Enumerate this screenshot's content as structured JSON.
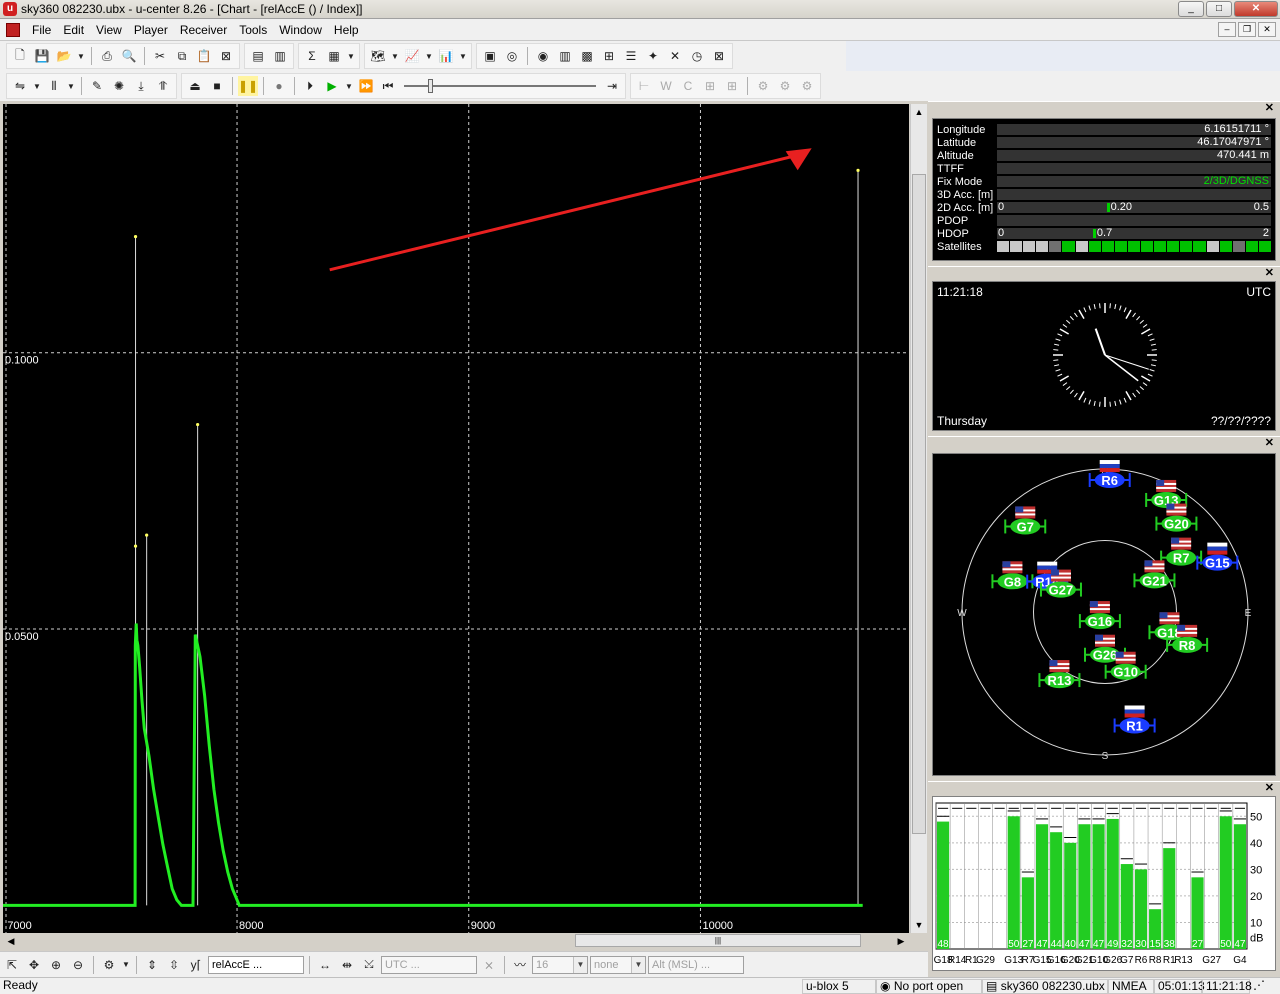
{
  "window": {
    "title": "sky360 082230.ubx - u-center 8.26 - [Chart - [relAccE () / Index]]",
    "min": "_",
    "max": "□",
    "close": "✕"
  },
  "menu": {
    "items": [
      "File",
      "Edit",
      "View",
      "Player",
      "Receiver",
      "Tools",
      "Window",
      "Help"
    ]
  },
  "chart": {
    "y_labels": [
      "0.1000",
      "0.0500"
    ],
    "x_labels": [
      "7000",
      "8000",
      "9000",
      "10000"
    ]
  },
  "chart_data": {
    "type": "line",
    "title": "",
    "xlabel": "",
    "ylabel": "",
    "xlim": [
      6990,
      10900
    ],
    "ylim": [
      -0.005,
      0.145
    ],
    "series": [
      {
        "color": "#22ee22",
        "x": [
          6990,
          7560,
          7561,
          7565,
          7568,
          7572,
          7580,
          7590,
          7600,
          7620,
          7640,
          7660,
          7680,
          7700,
          7720,
          7740,
          7760,
          7770,
          7780,
          7800,
          7810,
          7820,
          7840,
          7860,
          7880,
          7900,
          7920,
          7940,
          7960,
          7980,
          8000,
          8010,
          8030,
          8100,
          8500,
          9000,
          9500,
          10000,
          10500,
          10700
        ],
        "y": [
          0.0,
          0.0,
          0.047,
          0.051,
          0.048,
          0.047,
          0.043,
          0.037,
          0.032,
          0.027,
          0.021,
          0.016,
          0.011,
          0.007,
          0.003,
          0.001,
          0.0,
          0.0,
          0.0,
          0.0,
          0.0,
          0.049,
          0.045,
          0.038,
          0.029,
          0.021,
          0.015,
          0.01,
          0.006,
          0.003,
          0.001,
          0.0,
          0.0,
          0.0,
          0.0,
          0.0,
          0.0,
          0.0,
          0.0,
          0.0
        ]
      }
    ],
    "spikes": [
      {
        "x": 7562,
        "y": 0.121
      },
      {
        "x": 7562,
        "y": 0.065
      },
      {
        "x": 7610,
        "y": 0.067
      },
      {
        "x": 7830,
        "y": 0.087
      },
      {
        "x": 10680,
        "y": 0.133
      }
    ],
    "gridlines_x": [
      8000,
      9000,
      10000
    ],
    "gridlines_y": [
      0.05,
      0.1
    ],
    "annotation": "red arrow pointing to final spike"
  },
  "data_view": {
    "rows": [
      {
        "label": "Longitude",
        "value": "6.16151711 °"
      },
      {
        "label": "Latitude",
        "value": "46.17047971 °"
      },
      {
        "label": "Altitude",
        "value": "470.441 m"
      },
      {
        "label": "TTFF",
        "value": ""
      },
      {
        "label": "Fix Mode",
        "value": "2/3D/DGNSS"
      },
      {
        "label": "3D Acc. [m]",
        "value": ""
      }
    ],
    "acc2d": {
      "label": "2D Acc. [m]",
      "lo": "0",
      "val": "0.20",
      "hi": "0.5",
      "fraction": 0.4
    },
    "pdop": {
      "label": "PDOP"
    },
    "hdop": {
      "label": "HDOP",
      "lo": "0",
      "val": "0.7",
      "hi": "2",
      "fraction": 0.35
    },
    "satellites": {
      "label": "Satellites",
      "cells": [
        "#c8c8c8",
        "#c8c8c8",
        "#c8c8c8",
        "#c8c8c8",
        "#707070",
        "#00c000",
        "#c8c8c8",
        "#00c000",
        "#00c000",
        "#00c000",
        "#00c000",
        "#00c000",
        "#00c000",
        "#00c000",
        "#00c000",
        "#00c000",
        "#c8c8c8",
        "#00c000",
        "#707070",
        "#00c000",
        "#00c000"
      ]
    }
  },
  "clock": {
    "time": "11:21:18",
    "zone": "UTC",
    "day": "Thursday",
    "date": "??/??/????"
  },
  "sky": {
    "north": "N",
    "south": "S",
    "east": "E",
    "west": "W",
    "sats": [
      {
        "id": "R6",
        "sys": "R",
        "az": 2,
        "el": 5
      },
      {
        "id": "G13",
        "sys": "G",
        "az": 28,
        "el": 8
      },
      {
        "id": "G7",
        "sys": "G",
        "az": 318,
        "el": 15
      },
      {
        "id": "G20",
        "sys": "G",
        "az": 38,
        "el": 17
      },
      {
        "id": "R7",
        "sys": "G",
        "az": 53,
        "el": 30
      },
      {
        "id": "G15",
        "sys": "R",
        "az": 65,
        "el": 12
      },
      {
        "id": "G8",
        "sys": "G",
        "az": 290,
        "el": 28
      },
      {
        "id": "R14",
        "sys": "R",
        "az": 300,
        "el": 48
      },
      {
        "id": "G27",
        "sys": "G",
        "az": 300,
        "el": 58
      },
      {
        "id": "G21",
        "sys": "G",
        "az": 55,
        "el": 52
      },
      {
        "id": "G16",
        "sys": "G",
        "az": 220,
        "el": 85
      },
      {
        "id": "G18",
        "sys": "G",
        "az": 105,
        "el": 48
      },
      {
        "id": "R8",
        "sys": "G",
        "az": 110,
        "el": 35
      },
      {
        "id": "R13",
        "sys": "G",
        "az": 215,
        "el": 40
      },
      {
        "id": "G26",
        "sys": "G",
        "az": 180,
        "el": 65
      },
      {
        "id": "G10",
        "sys": "G",
        "az": 160,
        "el": 52
      },
      {
        "id": "R1",
        "sys": "R",
        "az": 165,
        "el": 18
      }
    ]
  },
  "signals": {
    "yticks": [
      "50",
      "40",
      "30",
      "20",
      "10"
    ],
    "unit": "dB",
    "bars": [
      {
        "name": "G18",
        "cn": 48,
        "label": "48",
        "col": "#22cc22"
      },
      {
        "name": "R14",
        "cn": 0,
        "label": "",
        "col": "#22cc22"
      },
      {
        "name": "R1",
        "cn": 0,
        "label": "",
        "col": "#22cc22"
      },
      {
        "name": "G29",
        "cn": 0,
        "label": "",
        "col": "#22cc22"
      },
      {
        "name": "",
        "cn": 0,
        "label": "",
        "col": "#22cc22"
      },
      {
        "name": "G13",
        "cn": 50,
        "label": "50",
        "col": "#22cc22"
      },
      {
        "name": "R7",
        "cn": 27,
        "label": "27",
        "col": "#22cc22"
      },
      {
        "name": "G15",
        "cn": 47,
        "label": "47",
        "col": "#22cc22"
      },
      {
        "name": "G16",
        "cn": 44,
        "label": "44",
        "col": "#22cc22"
      },
      {
        "name": "G20",
        "cn": 40,
        "label": "40",
        "col": "#22cc22"
      },
      {
        "name": "G21",
        "cn": 47,
        "label": "47",
        "col": "#22cc22"
      },
      {
        "name": "G10",
        "cn": 47,
        "label": "47",
        "col": "#22cc22"
      },
      {
        "name": "G26",
        "cn": 49,
        "label": "49",
        "col": "#22cc22"
      },
      {
        "name": "G7",
        "cn": 32,
        "label": "32",
        "col": "#22cc22"
      },
      {
        "name": "R6",
        "cn": 30,
        "label": "30",
        "col": "#22cc22"
      },
      {
        "name": "R8",
        "cn": 15,
        "label": "15",
        "col": "#22cc22"
      },
      {
        "name": "R1",
        "cn": 38,
        "label": "38",
        "col": "#22cc22"
      },
      {
        "name": "R13",
        "cn": 0,
        "label": "",
        "col": "#22cc22"
      },
      {
        "name": "",
        "cn": 27,
        "label": "27",
        "col": "#22cc22"
      },
      {
        "name": "G27",
        "cn": 0,
        "label": "",
        "col": "#22cc22"
      },
      {
        "name": "",
        "cn": 50,
        "label": "50",
        "col": "#22cc22"
      },
      {
        "name": "G4",
        "cn": 47,
        "label": "47",
        "col": "#22cc22"
      }
    ]
  },
  "bottom": {
    "field_name": "relAccE ...",
    "utc": "UTC ...",
    "size": "16",
    "none": "none",
    "alt": "Alt (MSL) ..."
  },
  "status": {
    "ready": "Ready",
    "device": "u-blox 5",
    "port": "No port open",
    "file": "sky360 082230.ubx",
    "protocol": "NMEA",
    "elapsed": "05:01:13",
    "time": "11:21:18"
  }
}
